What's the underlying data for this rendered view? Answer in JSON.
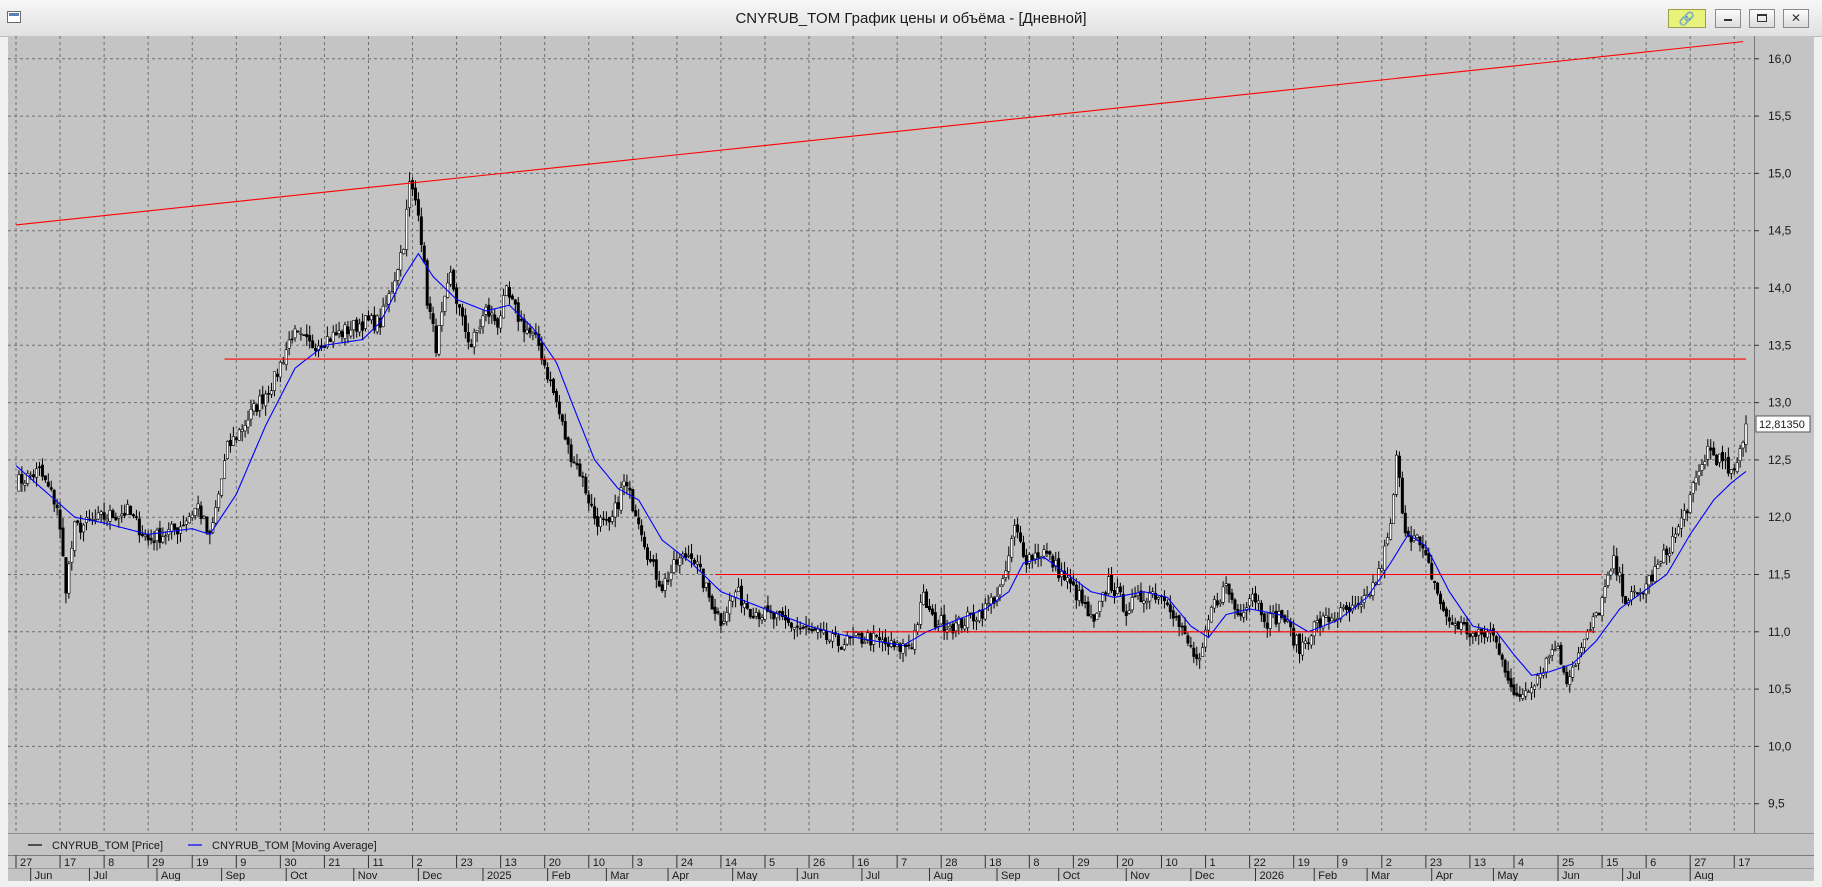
{
  "window": {
    "title": "CNYRUB_TOM График цены и объёма - [Дневной]",
    "link_icon": "link-icon",
    "controls": [
      "minimize-icon",
      "maximize-icon",
      "close-icon"
    ]
  },
  "chart_data": {
    "type": "candlestick",
    "instrument": "CNYRUB_TOM",
    "ylim": [
      9.1,
      16.3
    ],
    "yticks": [
      "16,0",
      "15,5",
      "15,0",
      "14,5",
      "14,0",
      "13,5",
      "13,0",
      "12,5",
      "12,0",
      "11,5",
      "11,0",
      "10,5",
      "10,0",
      "9,5"
    ],
    "ytick_values": [
      16.0,
      15.5,
      15.0,
      14.5,
      14.0,
      13.5,
      13.0,
      12.5,
      12.0,
      11.5,
      11.0,
      10.5,
      10.0,
      9.5
    ],
    "grid": true,
    "last_price_label": "12,81350",
    "last_price": 12.8135,
    "legend": {
      "position": "bottom-left",
      "entries": [
        {
          "label": "CNYRUB_TOM [Price]",
          "color": "#000000"
        },
        {
          "label": "CNYRUB_TOM [Moving Average]",
          "color": "#0000ff"
        }
      ]
    },
    "x_axis": {
      "day_ticks": [
        {
          "i": 0,
          "label": "27"
        },
        {
          "i": 15,
          "label": "17"
        },
        {
          "i": 30,
          "label": "8"
        },
        {
          "i": 45,
          "label": "29"
        },
        {
          "i": 60,
          "label": "19"
        },
        {
          "i": 75,
          "label": "9"
        },
        {
          "i": 90,
          "label": "30"
        },
        {
          "i": 105,
          "label": "21"
        },
        {
          "i": 120,
          "label": "11"
        },
        {
          "i": 135,
          "label": "2"
        },
        {
          "i": 150,
          "label": "23"
        },
        {
          "i": 165,
          "label": "13"
        },
        {
          "i": 180,
          "label": "20"
        },
        {
          "i": 195,
          "label": "10"
        },
        {
          "i": 210,
          "label": "3"
        },
        {
          "i": 225,
          "label": "24"
        },
        {
          "i": 240,
          "label": "14"
        },
        {
          "i": 255,
          "label": "5"
        },
        {
          "i": 270,
          "label": "26"
        },
        {
          "i": 285,
          "label": "16"
        },
        {
          "i": 300,
          "label": "7"
        },
        {
          "i": 315,
          "label": "28"
        },
        {
          "i": 330,
          "label": "18"
        },
        {
          "i": 345,
          "label": "8"
        },
        {
          "i": 360,
          "label": "29"
        },
        {
          "i": 375,
          "label": "20"
        },
        {
          "i": 390,
          "label": "10"
        },
        {
          "i": 405,
          "label": "1"
        },
        {
          "i": 420,
          "label": "22"
        },
        {
          "i": 435,
          "label": "19"
        },
        {
          "i": 450,
          "label": "9"
        },
        {
          "i": 465,
          "label": "2"
        },
        {
          "i": 480,
          "label": "23"
        },
        {
          "i": 495,
          "label": "13"
        },
        {
          "i": 510,
          "label": "4"
        },
        {
          "i": 525,
          "label": "25"
        },
        {
          "i": 540,
          "label": "15"
        },
        {
          "i": 555,
          "label": "6"
        },
        {
          "i": 570,
          "label": "27"
        },
        {
          "i": 585,
          "label": "17"
        }
      ],
      "month_ticks": [
        {
          "i": 5,
          "label": "Jun"
        },
        {
          "i": 25,
          "label": "Jul"
        },
        {
          "i": 48,
          "label": "Aug"
        },
        {
          "i": 70,
          "label": "Sep"
        },
        {
          "i": 92,
          "label": "Oct"
        },
        {
          "i": 115,
          "label": "Nov"
        },
        {
          "i": 137,
          "label": "Dec"
        },
        {
          "i": 159,
          "label": "2025"
        },
        {
          "i": 181,
          "label": "Feb"
        },
        {
          "i": 201,
          "label": "Mar"
        },
        {
          "i": 222,
          "label": "Apr"
        },
        {
          "i": 244,
          "label": "May"
        },
        {
          "i": 266,
          "label": "Jun"
        },
        {
          "i": 288,
          "label": "Jul"
        },
        {
          "i": 311,
          "label": "Aug"
        },
        {
          "i": 334,
          "label": "Sep"
        },
        {
          "i": 355,
          "label": "Oct"
        },
        {
          "i": 378,
          "label": "Nov"
        },
        {
          "i": 400,
          "label": "Dec"
        },
        {
          "i": 422,
          "label": "2026"
        },
        {
          "i": 442,
          "label": "Feb"
        },
        {
          "i": 460,
          "label": "Mar"
        },
        {
          "i": 482,
          "label": "Apr"
        },
        {
          "i": 503,
          "label": "May"
        },
        {
          "i": 525,
          "label": "Jun"
        },
        {
          "i": 547,
          "label": "Jul"
        },
        {
          "i": 570,
          "label": "Aug"
        }
      ]
    },
    "n_bars": 590,
    "price_anchors": [
      [
        0,
        12.3
      ],
      [
        8,
        12.4
      ],
      [
        14,
        12.1
      ],
      [
        17,
        11.4
      ],
      [
        20,
        11.9
      ],
      [
        30,
        12.0
      ],
      [
        38,
        12.05
      ],
      [
        45,
        11.8
      ],
      [
        55,
        11.9
      ],
      [
        62,
        12.1
      ],
      [
        66,
        11.8
      ],
      [
        72,
        12.6
      ],
      [
        80,
        12.9
      ],
      [
        88,
        13.2
      ],
      [
        94,
        13.6
      ],
      [
        100,
        13.5
      ],
      [
        110,
        13.6
      ],
      [
        118,
        13.7
      ],
      [
        124,
        13.7
      ],
      [
        128,
        14.0
      ],
      [
        132,
        14.4
      ],
      [
        134,
        14.9
      ],
      [
        137,
        14.7
      ],
      [
        140,
        13.9
      ],
      [
        143,
        13.5
      ],
      [
        148,
        14.1
      ],
      [
        152,
        13.7
      ],
      [
        155,
        13.5
      ],
      [
        160,
        13.8
      ],
      [
        164,
        13.7
      ],
      [
        167,
        13.95
      ],
      [
        172,
        13.7
      ],
      [
        178,
        13.5
      ],
      [
        184,
        13.0
      ],
      [
        188,
        12.6
      ],
      [
        192,
        12.4
      ],
      [
        197,
        12.0
      ],
      [
        202,
        11.9
      ],
      [
        207,
        12.3
      ],
      [
        212,
        12.0
      ],
      [
        216,
        11.6
      ],
      [
        220,
        11.4
      ],
      [
        225,
        11.6
      ],
      [
        230,
        11.7
      ],
      [
        236,
        11.3
      ],
      [
        240,
        11.1
      ],
      [
        245,
        11.35
      ],
      [
        250,
        11.2
      ],
      [
        260,
        11.1
      ],
      [
        270,
        11.0
      ],
      [
        280,
        10.9
      ],
      [
        290,
        10.95
      ],
      [
        300,
        10.85
      ],
      [
        305,
        10.9
      ],
      [
        309,
        11.3
      ],
      [
        312,
        11.1
      ],
      [
        320,
        11.05
      ],
      [
        330,
        11.2
      ],
      [
        336,
        11.4
      ],
      [
        340,
        11.9
      ],
      [
        344,
        11.65
      ],
      [
        350,
        11.7
      ],
      [
        356,
        11.5
      ],
      [
        362,
        11.3
      ],
      [
        367,
        11.05
      ],
      [
        372,
        11.45
      ],
      [
        378,
        11.2
      ],
      [
        386,
        11.35
      ],
      [
        392,
        11.3
      ],
      [
        396,
        11.05
      ],
      [
        400,
        10.85
      ],
      [
        403,
        10.7
      ],
      [
        407,
        11.2
      ],
      [
        412,
        11.4
      ],
      [
        416,
        11.15
      ],
      [
        421,
        11.35
      ],
      [
        426,
        11.1
      ],
      [
        431,
        11.15
      ],
      [
        437,
        10.85
      ],
      [
        442,
        11.05
      ],
      [
        450,
        11.15
      ],
      [
        458,
        11.2
      ],
      [
        464,
        11.5
      ],
      [
        468,
        11.9
      ],
      [
        470,
        12.5
      ],
      [
        473,
        11.9
      ],
      [
        477,
        11.8
      ],
      [
        482,
        11.5
      ],
      [
        487,
        11.1
      ],
      [
        492,
        11.05
      ],
      [
        497,
        10.95
      ],
      [
        502,
        11.0
      ],
      [
        506,
        10.8
      ],
      [
        510,
        10.4
      ],
      [
        514,
        10.5
      ],
      [
        519,
        10.65
      ],
      [
        524,
        10.9
      ],
      [
        528,
        10.6
      ],
      [
        534,
        10.9
      ],
      [
        539,
        11.2
      ],
      [
        544,
        11.6
      ],
      [
        548,
        11.3
      ],
      [
        552,
        11.3
      ],
      [
        560,
        11.6
      ],
      [
        566,
        11.9
      ],
      [
        572,
        12.3
      ],
      [
        576,
        12.6
      ],
      [
        580,
        12.5
      ],
      [
        585,
        12.35
      ],
      [
        589,
        12.81
      ]
    ],
    "moving_average_anchors": [
      [
        0,
        12.45
      ],
      [
        20,
        12.0
      ],
      [
        30,
        11.95
      ],
      [
        45,
        11.85
      ],
      [
        60,
        11.9
      ],
      [
        66,
        11.85
      ],
      [
        75,
        12.2
      ],
      [
        85,
        12.8
      ],
      [
        95,
        13.3
      ],
      [
        105,
        13.5
      ],
      [
        118,
        13.55
      ],
      [
        124,
        13.7
      ],
      [
        132,
        14.1
      ],
      [
        137,
        14.3
      ],
      [
        142,
        14.1
      ],
      [
        150,
        13.9
      ],
      [
        160,
        13.8
      ],
      [
        168,
        13.85
      ],
      [
        176,
        13.65
      ],
      [
        184,
        13.35
      ],
      [
        190,
        12.95
      ],
      [
        197,
        12.5
      ],
      [
        205,
        12.25
      ],
      [
        212,
        12.15
      ],
      [
        220,
        11.8
      ],
      [
        230,
        11.6
      ],
      [
        240,
        11.35
      ],
      [
        250,
        11.25
      ],
      [
        260,
        11.15
      ],
      [
        270,
        11.05
      ],
      [
        280,
        10.98
      ],
      [
        290,
        10.93
      ],
      [
        302,
        10.88
      ],
      [
        310,
        11.0
      ],
      [
        320,
        11.1
      ],
      [
        330,
        11.2
      ],
      [
        338,
        11.35
      ],
      [
        343,
        11.6
      ],
      [
        350,
        11.65
      ],
      [
        358,
        11.5
      ],
      [
        366,
        11.35
      ],
      [
        374,
        11.3
      ],
      [
        384,
        11.35
      ],
      [
        392,
        11.3
      ],
      [
        400,
        11.05
      ],
      [
        406,
        10.95
      ],
      [
        412,
        11.15
      ],
      [
        420,
        11.2
      ],
      [
        430,
        11.15
      ],
      [
        440,
        11.0
      ],
      [
        450,
        11.1
      ],
      [
        460,
        11.3
      ],
      [
        468,
        11.6
      ],
      [
        474,
        11.85
      ],
      [
        480,
        11.75
      ],
      [
        488,
        11.35
      ],
      [
        496,
        11.05
      ],
      [
        504,
        11.0
      ],
      [
        510,
        10.8
      ],
      [
        516,
        10.62
      ],
      [
        522,
        10.65
      ],
      [
        530,
        10.72
      ],
      [
        538,
        10.92
      ],
      [
        546,
        11.2
      ],
      [
        554,
        11.35
      ],
      [
        562,
        11.5
      ],
      [
        570,
        11.85
      ],
      [
        578,
        12.15
      ],
      [
        584,
        12.3
      ],
      [
        589,
        12.4
      ]
    ],
    "reference_lines": [
      {
        "name": "trendline",
        "color": "#ff0000",
        "from": [
          0,
          14.55
        ],
        "to": [
          588,
          16.15
        ]
      },
      {
        "name": "resistance-13-38",
        "color": "#ff0000",
        "from": [
          71,
          13.38
        ],
        "to": [
          590,
          13.38
        ]
      },
      {
        "name": "channel-top-11-5",
        "color": "#ff0000",
        "from": [
          238,
          11.5
        ],
        "to": [
          540,
          11.5
        ]
      },
      {
        "name": "channel-bottom-11-0",
        "color": "#ff0000",
        "from": [
          282,
          11.0
        ],
        "to": [
          538,
          11.0
        ]
      }
    ]
  }
}
